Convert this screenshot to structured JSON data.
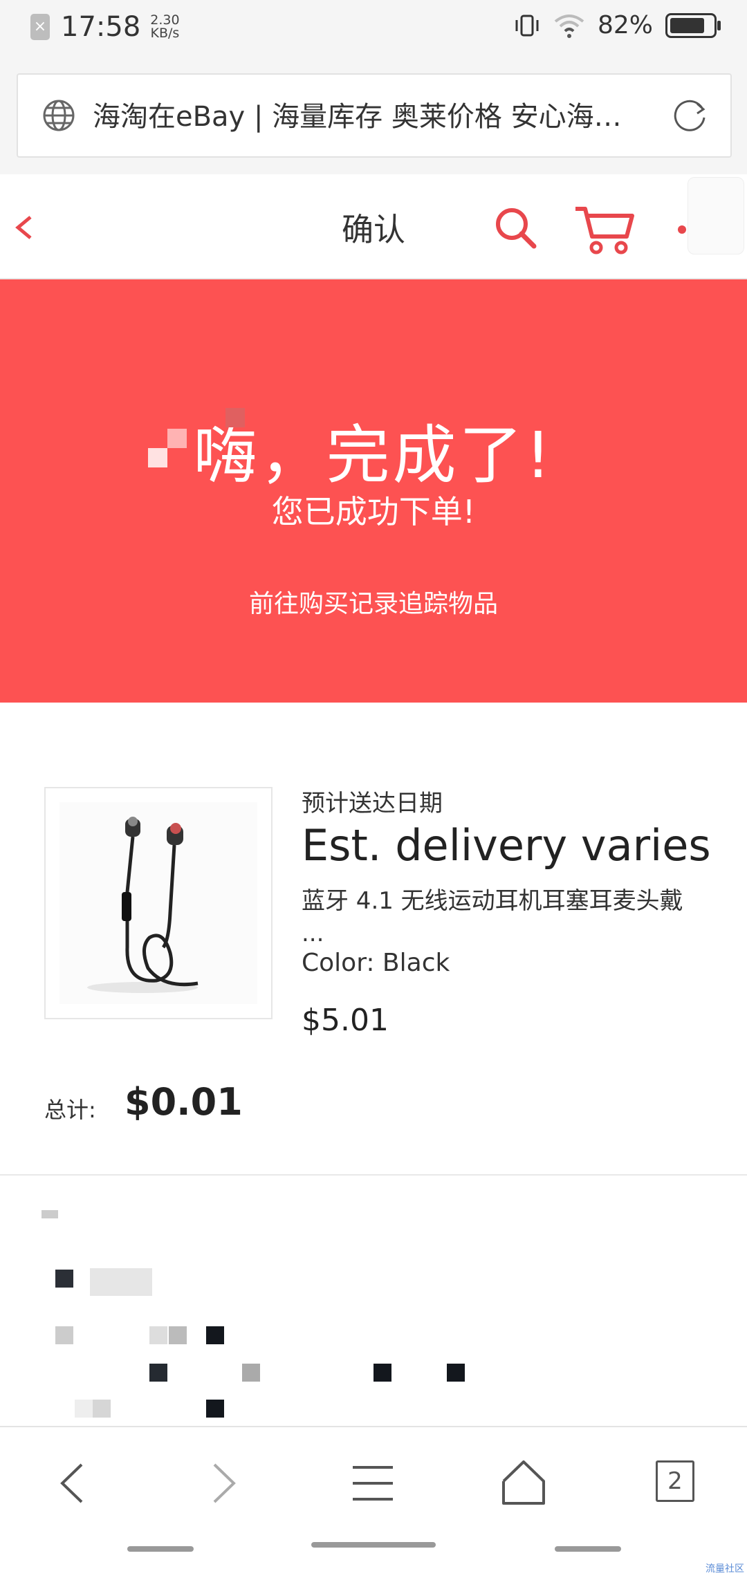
{
  "status_bar": {
    "time": "17:58",
    "speed_value": "2.30",
    "speed_unit": "KB/s",
    "battery": "82%",
    "battery_level": 0.82
  },
  "browser": {
    "url_title": "海淘在eBay | 海量库存 奥莱价格 安心海…"
  },
  "header": {
    "title": "确认"
  },
  "hero": {
    "title": "嗨，完成了!",
    "subtitle": "您已成功下单!",
    "link": "前往购买记录追踪物品"
  },
  "order": {
    "delivery_label": "预计送达日期",
    "delivery_value": "Est. delivery varies",
    "product_title": "蓝牙 4.1 无线运动耳机耳塞耳麦头戴",
    "product_title_ellipsis": "...",
    "color": "Color: Black",
    "price": "$5.01",
    "total_label": "总计:",
    "total_value": "$0.01"
  },
  "nav": {
    "tab_count": "2"
  },
  "watermark": "流量社区",
  "colors": {
    "accent": "#fd5252",
    "icon_red": "#e8474c"
  }
}
